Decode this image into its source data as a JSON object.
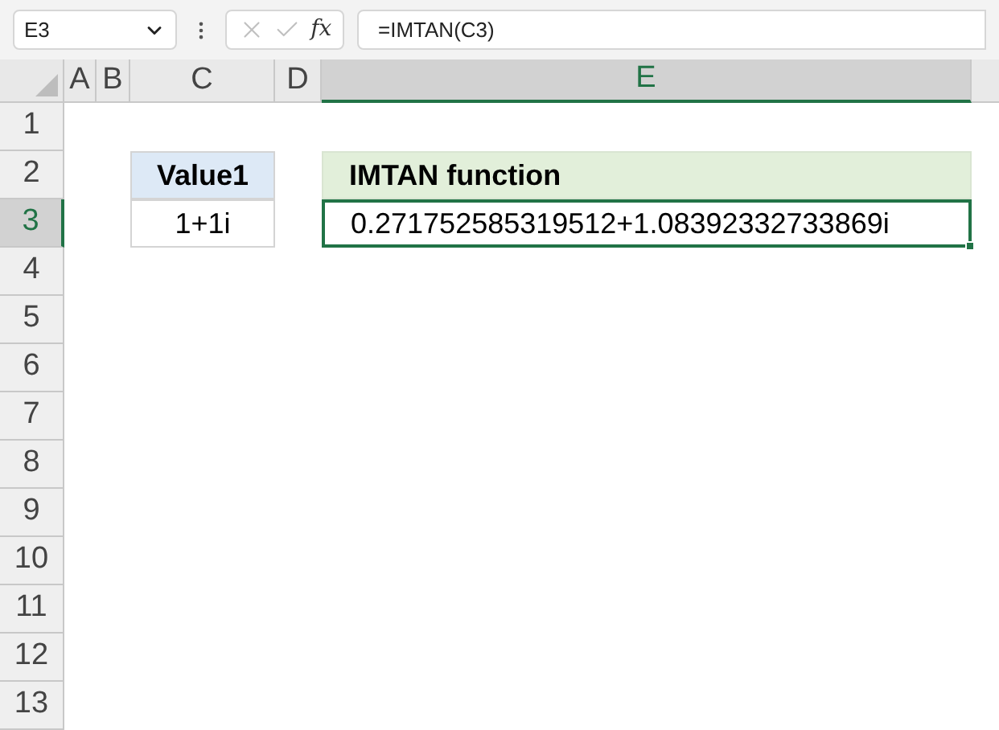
{
  "formula_bar": {
    "name_box": "E3",
    "fx_label": "fx",
    "formula": "=IMTAN(C3)"
  },
  "columns": [
    {
      "label": "A",
      "selected": false
    },
    {
      "label": "B",
      "selected": false
    },
    {
      "label": "C",
      "selected": false
    },
    {
      "label": "D",
      "selected": false
    },
    {
      "label": "E",
      "selected": true
    }
  ],
  "rows": [
    {
      "label": "1",
      "selected": false,
      "cells": [
        null,
        null,
        null,
        null,
        null
      ]
    },
    {
      "label": "2",
      "selected": false,
      "cells": [
        null,
        null,
        {
          "text": "Value1",
          "kind": "header",
          "selected": false
        },
        null,
        {
          "text": "IMTAN function",
          "kind": "result_header",
          "selected": false
        }
      ]
    },
    {
      "label": "3",
      "selected": true,
      "cells": [
        null,
        null,
        {
          "text": "1+1i",
          "kind": "value",
          "selected": false
        },
        null,
        {
          "text": "0.271752585319512+1.08392332733869i",
          "kind": "value",
          "selected": true
        }
      ]
    },
    {
      "label": "4",
      "selected": false,
      "cells": [
        null,
        null,
        null,
        null,
        null
      ]
    },
    {
      "label": "5",
      "selected": false,
      "cells": [
        null,
        null,
        null,
        null,
        null
      ]
    },
    {
      "label": "6",
      "selected": false,
      "cells": [
        null,
        null,
        null,
        null,
        null
      ]
    },
    {
      "label": "7",
      "selected": false,
      "cells": [
        null,
        null,
        null,
        null,
        null
      ]
    },
    {
      "label": "8",
      "selected": false,
      "cells": [
        null,
        null,
        null,
        null,
        null
      ]
    },
    {
      "label": "9",
      "selected": false,
      "cells": [
        null,
        null,
        null,
        null,
        null
      ]
    },
    {
      "label": "10",
      "selected": false,
      "cells": [
        null,
        null,
        null,
        null,
        null
      ]
    },
    {
      "label": "11",
      "selected": false,
      "cells": [
        null,
        null,
        null,
        null,
        null
      ]
    },
    {
      "label": "12",
      "selected": false,
      "cells": [
        null,
        null,
        null,
        null,
        null
      ]
    },
    {
      "label": "13",
      "selected": false,
      "cells": [
        null,
        null,
        null,
        null,
        null
      ]
    }
  ]
}
